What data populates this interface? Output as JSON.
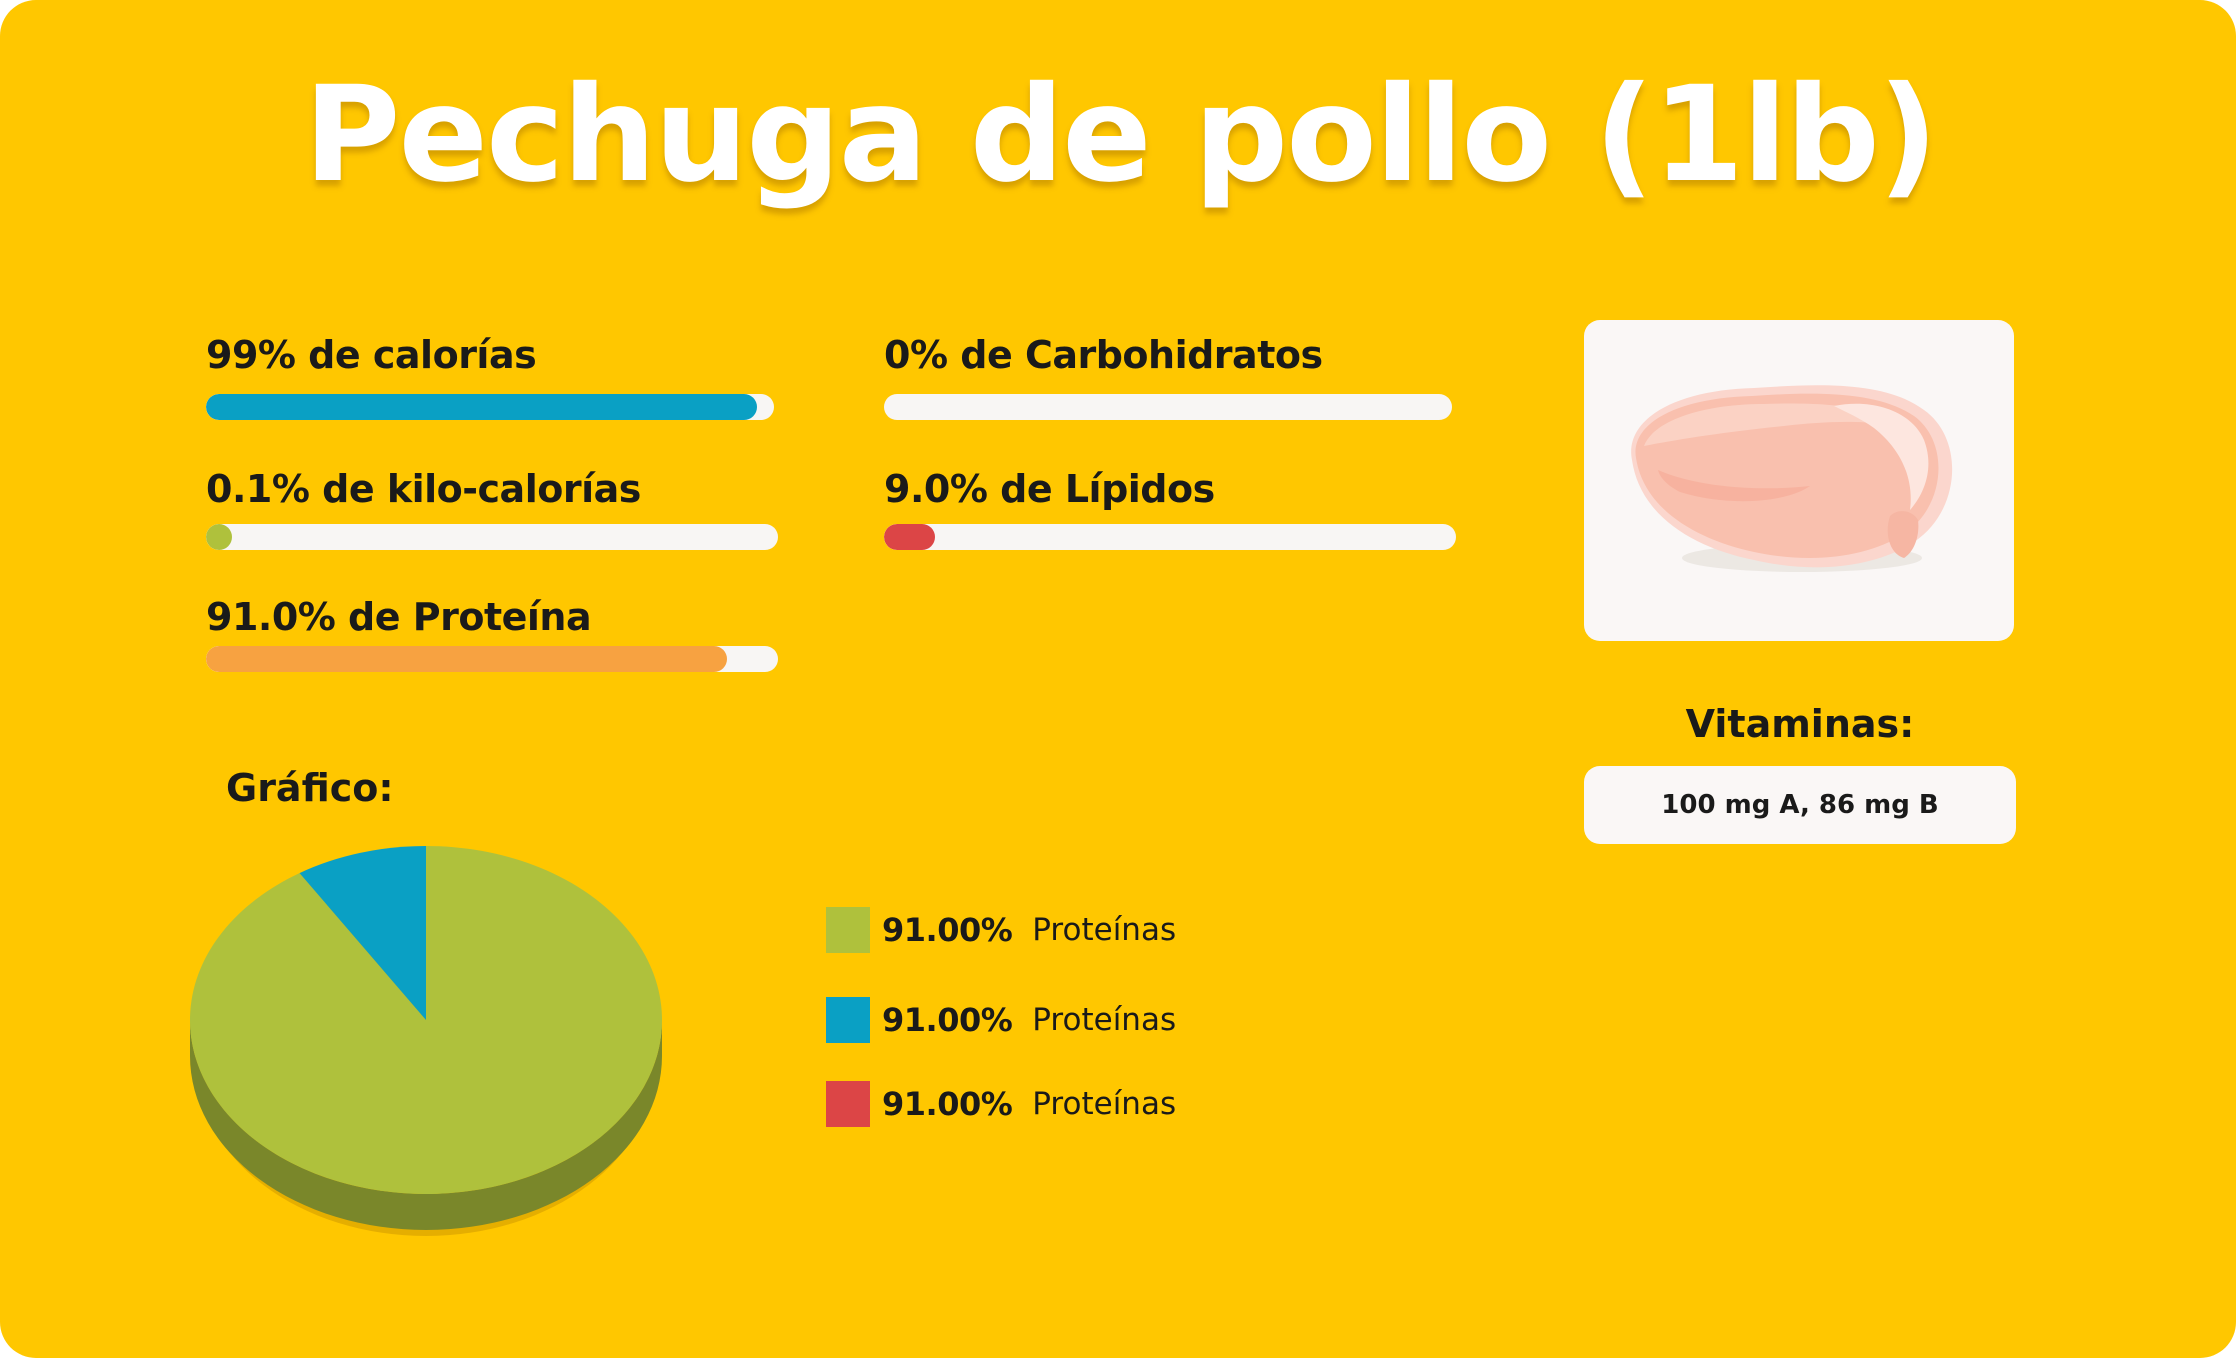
{
  "title": "Pechuga de pollo (1lb)",
  "colors": {
    "background": "#ffc700",
    "calories": "#0aa0c4",
    "kilocalories": "#afc13c",
    "protein": "#f7a241",
    "lipids": "#dc4546",
    "carbs": "#ffffff",
    "track": "#f8f6f4"
  },
  "stats": {
    "calories": {
      "label": "99% de calorías",
      "fraction": 0.97
    },
    "carbs": {
      "label": "0% de Carbohidratos",
      "fraction": 0.0
    },
    "kilocalories": {
      "label": "0.1% de kilo-calorías",
      "fraction": 0.04
    },
    "lipids": {
      "label": "9.0% de Lípidos",
      "fraction": 0.09
    },
    "protein": {
      "label": "91.0% de Proteína",
      "fraction": 0.91
    }
  },
  "chart": {
    "heading": "Gráfico:"
  },
  "chart_data": {
    "type": "pie",
    "title": "",
    "slices": [
      {
        "label": "Proteínas",
        "value": 91.0,
        "color": "#afc13c"
      },
      {
        "label": "Proteínas",
        "value": 9.0,
        "color": "#0aa0c4"
      },
      {
        "label": "Proteínas",
        "value": 0.0,
        "color": "#dc4546"
      }
    ],
    "legend": [
      {
        "value": "91.00%",
        "name": "Proteínas",
        "color": "#afc13c"
      },
      {
        "value": "91.00%",
        "name": "Proteínas",
        "color": "#0aa0c4"
      },
      {
        "value": "91.00%",
        "name": "Proteínas",
        "color": "#dc4546"
      }
    ]
  },
  "image": {
    "icon": "chicken-breast-icon"
  },
  "vitamins": {
    "heading": "Vitaminas:",
    "value": "100 mg A, 86 mg B"
  }
}
